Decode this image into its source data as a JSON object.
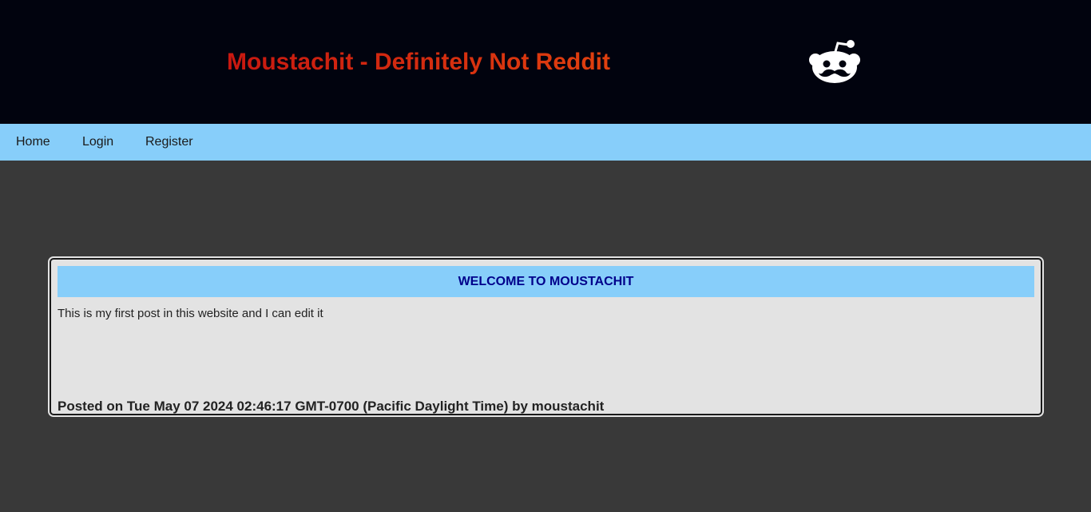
{
  "header": {
    "title": "Moustachit - Definitely Not Reddit",
    "title_gradient": [
      "#c81810",
      "#e0400f"
    ],
    "logo_icon": "reddit-moustache-icon"
  },
  "nav": {
    "items": [
      {
        "label": "Home"
      },
      {
        "label": "Login"
      },
      {
        "label": "Register"
      }
    ]
  },
  "post": {
    "title": "WELCOME TO MOUSTACHIT",
    "body": "This is my first post in this website and I can edit it",
    "meta": "Posted on Tue May 07 2024 02:46:17 GMT-0700 (Pacific Daylight Time) by moustachit"
  },
  "colors": {
    "header_bg": "#01030e",
    "nav_bg": "#87cefa",
    "page_bg": "#393939",
    "card_bg": "#e3e3e3",
    "post_title_color": "#00008b"
  }
}
